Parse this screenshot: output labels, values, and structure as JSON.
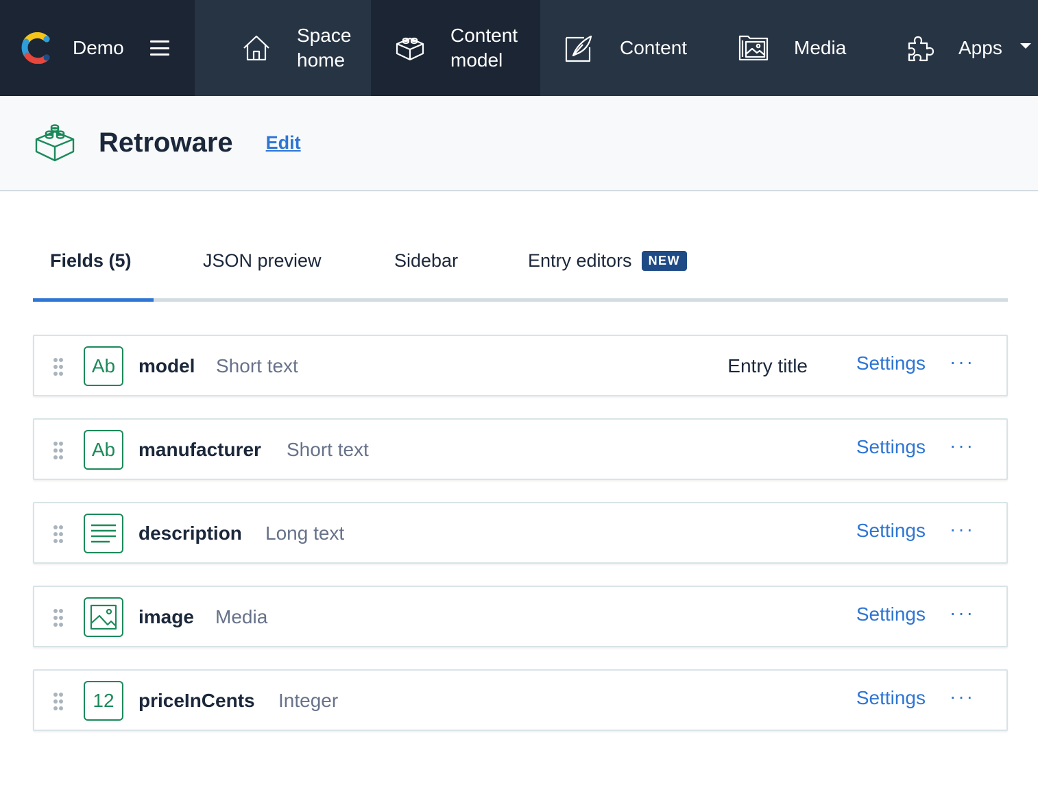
{
  "app": {
    "space_name": "Demo",
    "accent_color": "#2e75d4",
    "nav_background": "#273444",
    "icon_color": "#1b8a5a"
  },
  "nav": {
    "items": [
      {
        "label_line1": "Space",
        "label_line2": "home",
        "icon": "house-icon"
      },
      {
        "label_line1": "Content",
        "label_line2": "model",
        "icon": "blocks-icon",
        "active": true
      },
      {
        "label": "Content",
        "icon": "feather-pen-icon"
      },
      {
        "label": "Media",
        "icon": "image-gallery-icon"
      },
      {
        "label": "Apps",
        "icon": "puzzle-icon"
      }
    ]
  },
  "header": {
    "title": "Retroware",
    "edit_label": "Edit",
    "icon": "blocks-icon"
  },
  "tabs": [
    {
      "label": "Fields (5)",
      "active": true
    },
    {
      "label": "JSON preview"
    },
    {
      "label": "Sidebar"
    },
    {
      "label": "Entry editors",
      "badge": "NEW"
    }
  ],
  "fields": [
    {
      "name": "model",
      "type": "Short text",
      "icon_text": "Ab",
      "entry_title_label": "Entry title",
      "settings_label": "Settings",
      "more_label": "···"
    },
    {
      "name": "manufacturer",
      "type": "Short text",
      "icon_text": "Ab",
      "settings_label": "Settings",
      "more_label": "···"
    },
    {
      "name": "description",
      "type": "Long text",
      "icon": "paragraph-icon",
      "settings_label": "Settings",
      "more_label": "···"
    },
    {
      "name": "image",
      "type": "Media",
      "icon": "image-icon",
      "settings_label": "Settings",
      "more_label": "···"
    },
    {
      "name": "priceInCents",
      "type": "Integer",
      "icon_text": "12",
      "settings_label": "Settings",
      "more_label": "···"
    }
  ]
}
